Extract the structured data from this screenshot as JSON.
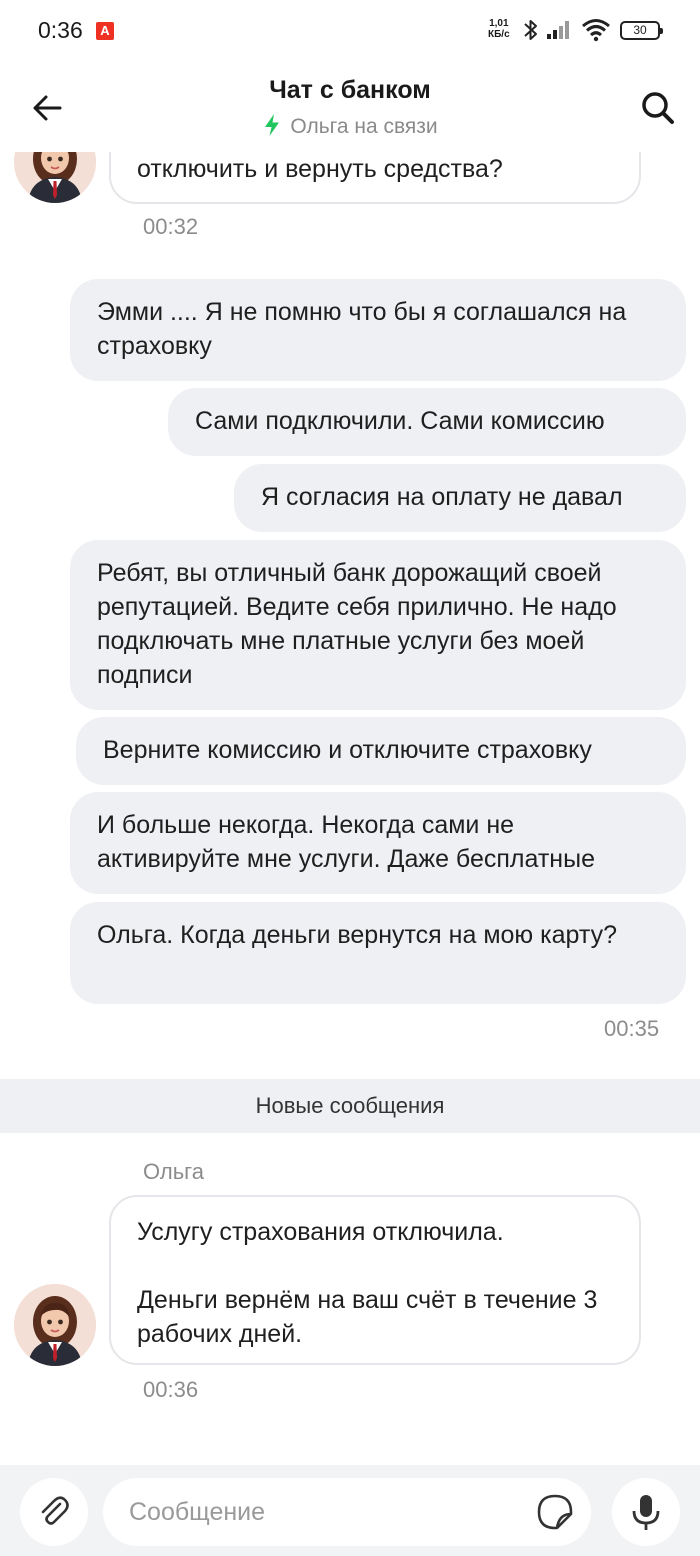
{
  "status_bar": {
    "time": "0:36",
    "app_badge": "А",
    "net_speed_value": "1,01",
    "net_speed_unit": "КБ/с",
    "battery": "30"
  },
  "header": {
    "title": "Чат с банком",
    "subtitle": "Ольга на связи",
    "accent_color": "#21c55d"
  },
  "messages": {
    "first_incoming": {
      "text": "отключить и вернуть средства?",
      "time": "00:32"
    },
    "outgoing": [
      {
        "text": "Эмми .... Я не помню что бы я соглашался на страховку"
      },
      {
        "text": "Сами подключили. Сами комиссию"
      },
      {
        "text": "Я согласия на оплату не давал"
      },
      {
        "text": "Ребят, вы отличный банк дорожащий своей репутацией. Ведите себя прилично. Не надо подключать мне платные услуги без моей подписи"
      },
      {
        "text": "Верните комиссию и отключите страховку"
      },
      {
        "text": "И больше некогда. Некогда сами не активируйте мне услуги. Даже бесплатные"
      },
      {
        "text": "Ольга. Когда деньги вернутся на мою карту?"
      }
    ],
    "outgoing_time": "00:35",
    "divider": "Новые сообщения",
    "sender_name": "Ольга",
    "last_incoming": {
      "line1": "Услугу страхования отключила.",
      "line2": "Деньги вернём на ваш счёт в течение 3 рабочих дней.",
      "time": "00:36"
    }
  },
  "composer": {
    "placeholder": "Сообщение"
  }
}
